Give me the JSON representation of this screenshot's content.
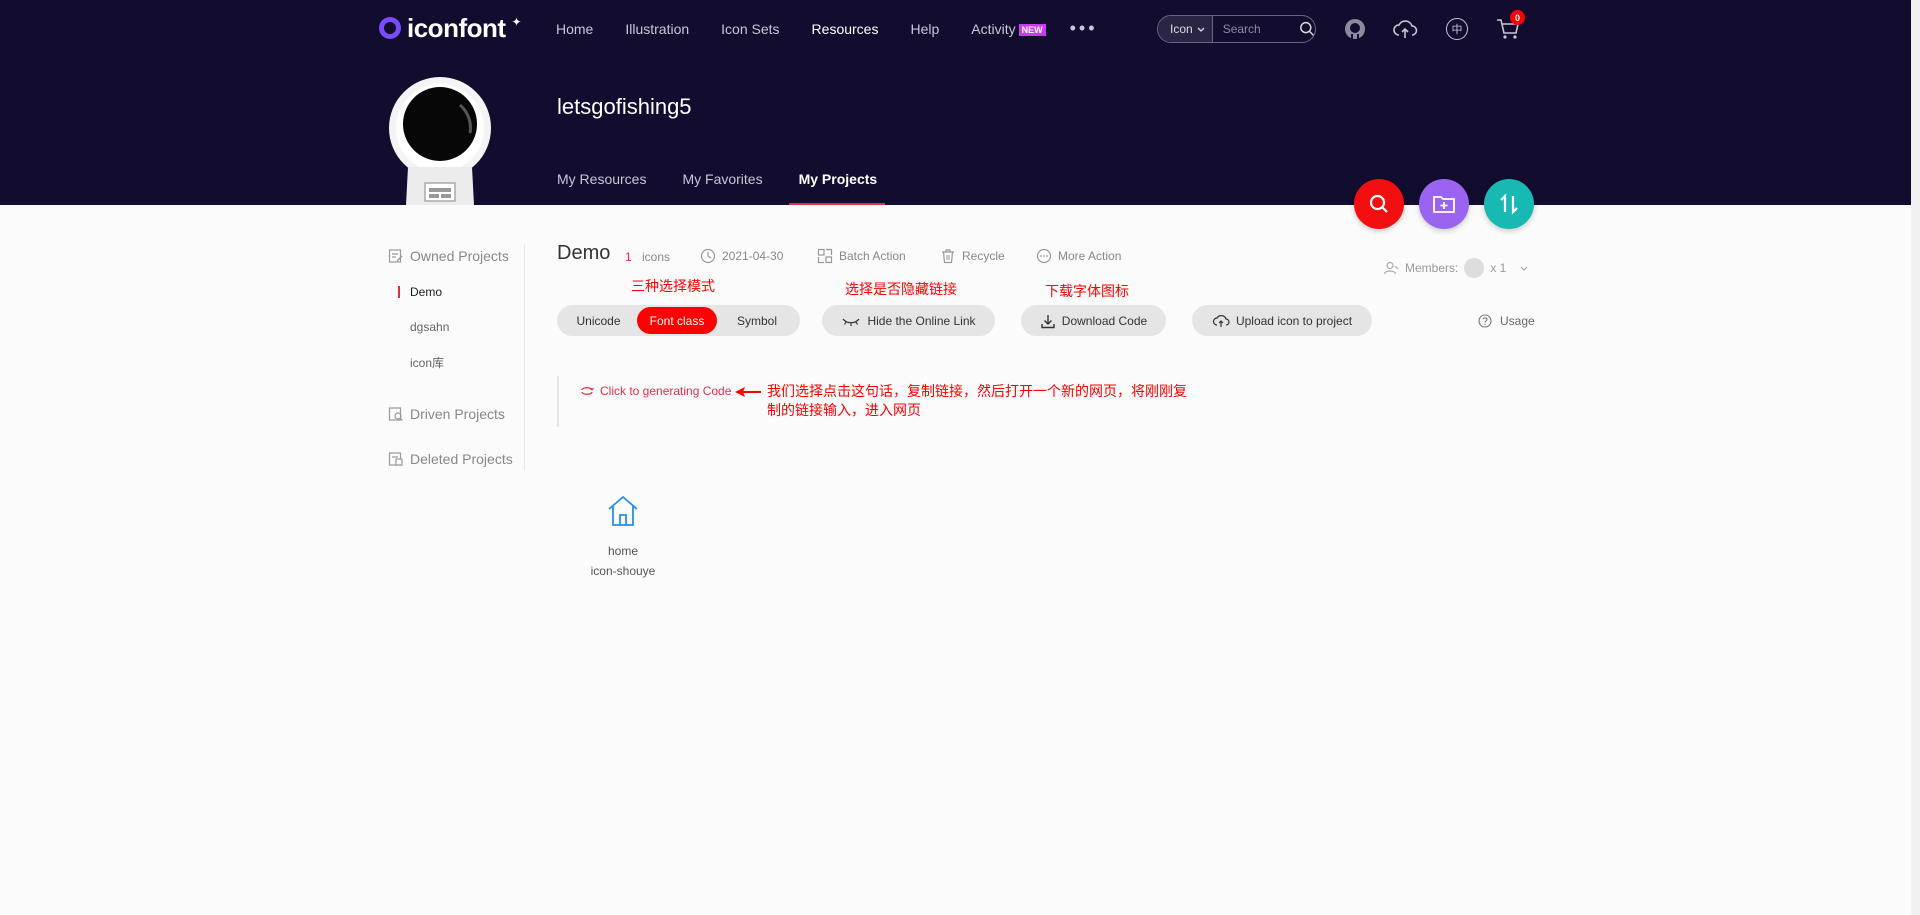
{
  "header": {
    "logo_text": "iconfont",
    "nav": [
      {
        "label": "Home",
        "active": false
      },
      {
        "label": "Illustration",
        "active": false
      },
      {
        "label": "Icon Sets",
        "active": false
      },
      {
        "label": "Resources",
        "active": true
      },
      {
        "label": "Help",
        "active": false
      },
      {
        "label": "Activity",
        "active": false
      }
    ],
    "activity_badge": "NEW",
    "search": {
      "type": "Icon",
      "placeholder": "Search"
    },
    "cart_count": "0",
    "lang_icon": "中"
  },
  "profile": {
    "username": "letsgofishing5",
    "tabs": [
      {
        "label": "My Resources",
        "active": false
      },
      {
        "label": "My Favorites",
        "active": false
      },
      {
        "label": "My Projects",
        "active": true
      }
    ]
  },
  "sidebar": {
    "owned_label": "Owned Projects",
    "projects": [
      {
        "label": "Demo",
        "active": true
      },
      {
        "label": "dgsahn",
        "active": false
      },
      {
        "label": "icon库",
        "active": false
      }
    ],
    "driven_label": "Driven Projects",
    "deleted_label": "Deleted Projects"
  },
  "project": {
    "name": "Demo",
    "icon_count": "1",
    "icons_label": "icons",
    "date": "2021-04-30",
    "batch_action": "Batch Action",
    "recycle": "Recycle",
    "more_action": "More Action",
    "members_label": "Members:",
    "members_count": "x 1",
    "usage": "Usage"
  },
  "modes": [
    "Unicode",
    "Font class",
    "Symbol"
  ],
  "active_mode": "Font class",
  "actions": {
    "hide_link": "Hide the Online Link",
    "download": "Download Code",
    "upload": "Upload icon to project"
  },
  "annotations": {
    "modes": "三种选择模式",
    "hide": "选择是否隐藏链接",
    "download": "下载字体图标",
    "explain": "我们选择点击这句话，复制链接，然后打开一个新的网页，将刚刚复制的链接输入，进入网页"
  },
  "code_link": "Click to generating Code",
  "icons": [
    {
      "name": "home",
      "code": "icon-shouye",
      "icon": "home-icon"
    }
  ],
  "colors": {
    "header_bg": "#120c2e",
    "accent_red": "#f00",
    "fab_search": "#f30f0f",
    "fab_folder": "#9a63f0",
    "fab_sort": "#18b9b3",
    "icon_blue": "#2a8fe6"
  }
}
